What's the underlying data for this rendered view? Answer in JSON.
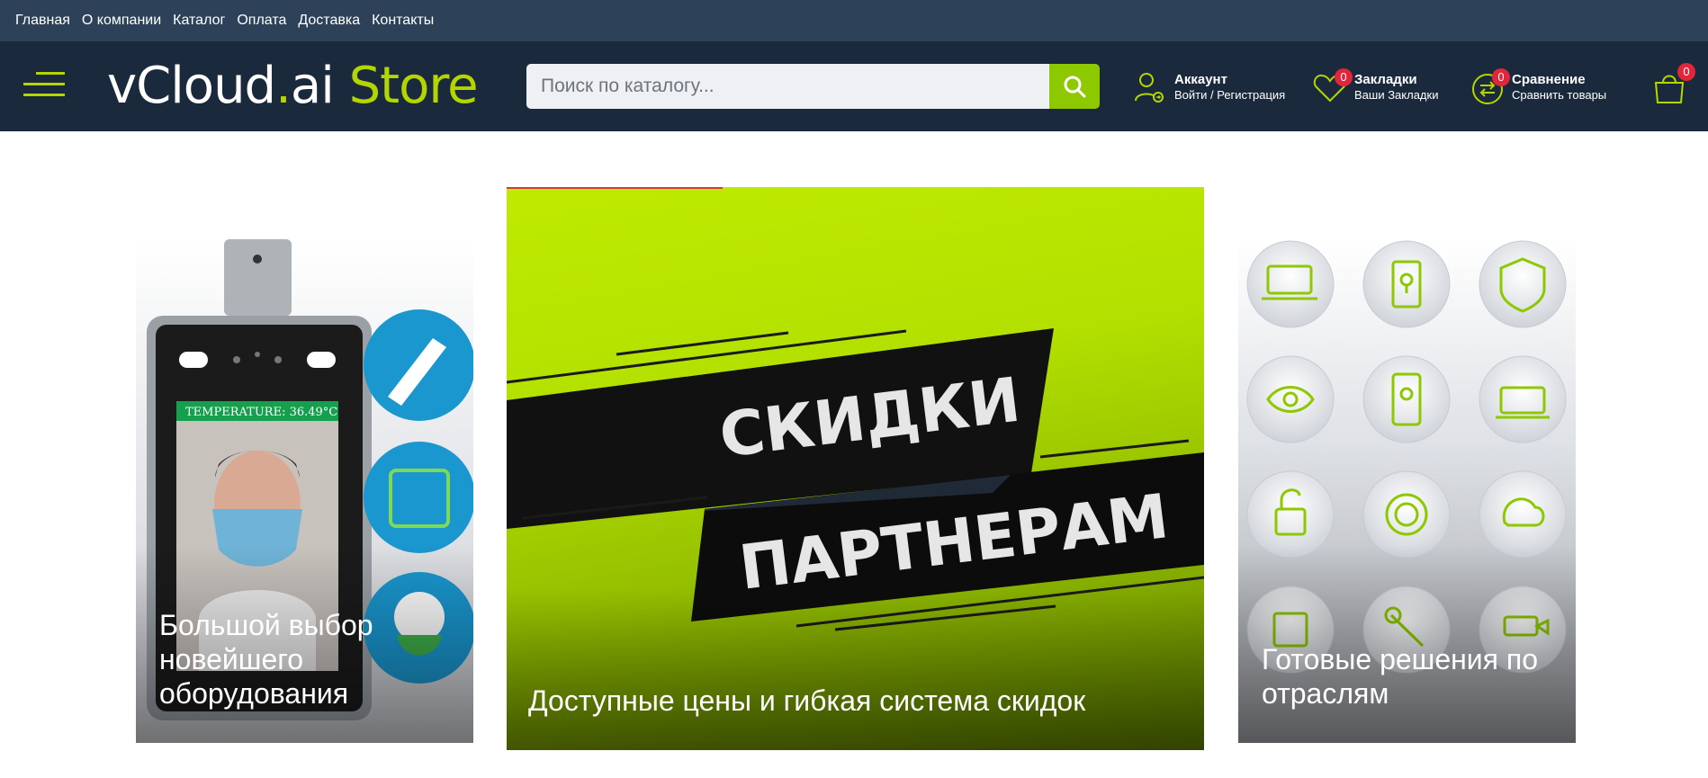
{
  "topnav": [
    "Главная",
    "О компании",
    "Каталог",
    "Оплата",
    "Доставка",
    "Контакты"
  ],
  "logo": {
    "part1": "vCloud",
    "dot": ".",
    "part2": "ai",
    "part3": " Store"
  },
  "search": {
    "placeholder": "Поиск по каталогу..."
  },
  "account": {
    "title": "Аккаунт",
    "subtitle": "Войти / Регистрация"
  },
  "bookmarks": {
    "title": "Закладки",
    "subtitle": "Ваши Закладки",
    "count": "0"
  },
  "compare": {
    "title": "Сравнение",
    "subtitle": "Сравнить товары",
    "count": "0"
  },
  "cart": {
    "count": "0"
  },
  "banners": {
    "left": {
      "caption": "Большой выбор новейшего оборудования",
      "screen_label": "TEMPERATURE: 36.49°C"
    },
    "middle": {
      "caption": "Доступные цены и гибкая система скидок",
      "line1": "СКИДКИ",
      "line2": "ПАРТНЕРАМ"
    },
    "right": {
      "caption": "Готовые решения по отраслям"
    }
  },
  "colors": {
    "accent": "#b4d600",
    "header": "#1a2a3c",
    "topbar": "#2d4259",
    "badge": "#e1253b"
  }
}
